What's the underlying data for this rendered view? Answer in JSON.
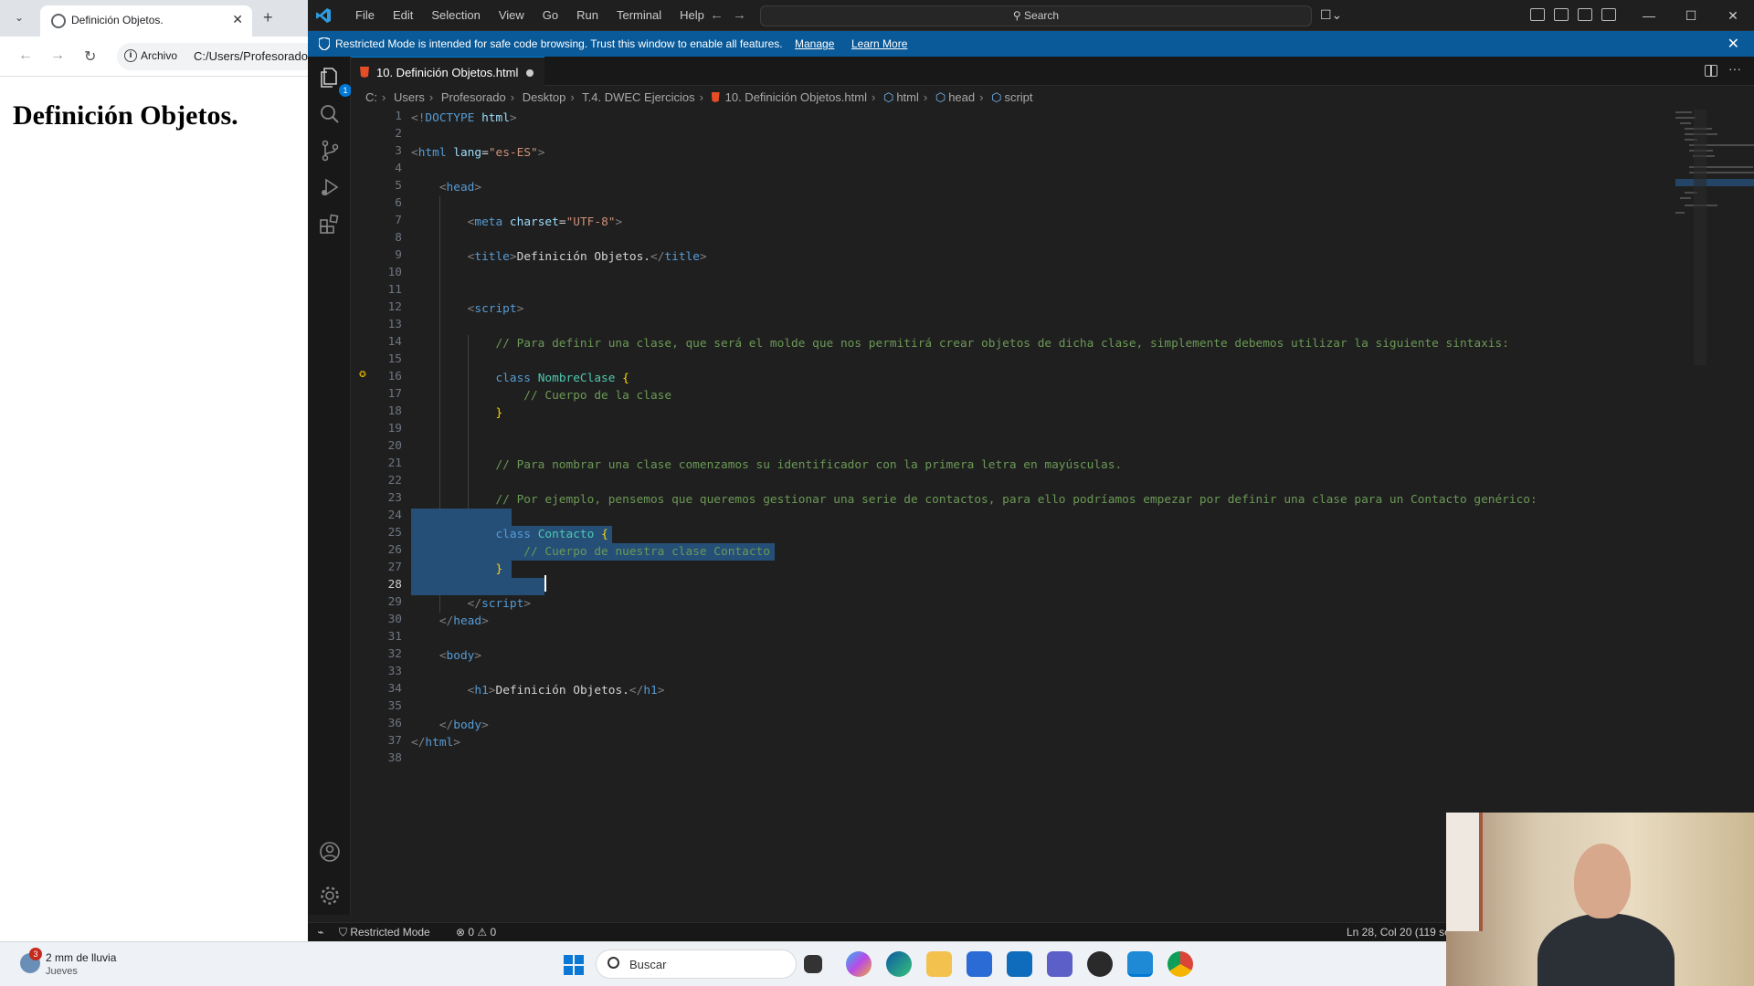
{
  "browser": {
    "tab_title": "Definición Objetos.",
    "omnibox_scheme": "Archivo",
    "omnibox_url": "C:/Users/Profesorado",
    "page_h1": "Definición Objetos."
  },
  "vscode": {
    "menu": [
      "File",
      "Edit",
      "Selection",
      "View",
      "Go",
      "Run",
      "Terminal",
      "Help"
    ],
    "search_placeholder": "Search",
    "banner": {
      "message": "Restricted Mode is intended for safe code browsing. Trust this window to enable all features.",
      "manage": "Manage",
      "learn_more": "Learn More"
    },
    "explorer_badge": "1",
    "tab_label": "10. Definición Objetos.html",
    "breadcrumb": {
      "path": [
        "C:",
        "Users",
        "Profesorado",
        "Desktop",
        "T.4. DWEC Ejercicios"
      ],
      "file": "10. Definición Objetos.html",
      "symbols": [
        "html",
        "head",
        "script"
      ]
    },
    "active_line": 28,
    "status": {
      "restricted": "Restricted Mode",
      "errors": "0",
      "warnings": "0",
      "position": "Ln 28, Col 20 (119 se"
    }
  },
  "taskbar": {
    "weather_badge": "3",
    "weather_line1": "2 mm de lluvia",
    "weather_line2": "Jueves",
    "search_placeholder": "Buscar"
  },
  "colors": {
    "editor_bg": "#1f1f1f",
    "banner_bg": "#0a5a99",
    "selection": "#264f78",
    "accent": "#0078d4"
  }
}
